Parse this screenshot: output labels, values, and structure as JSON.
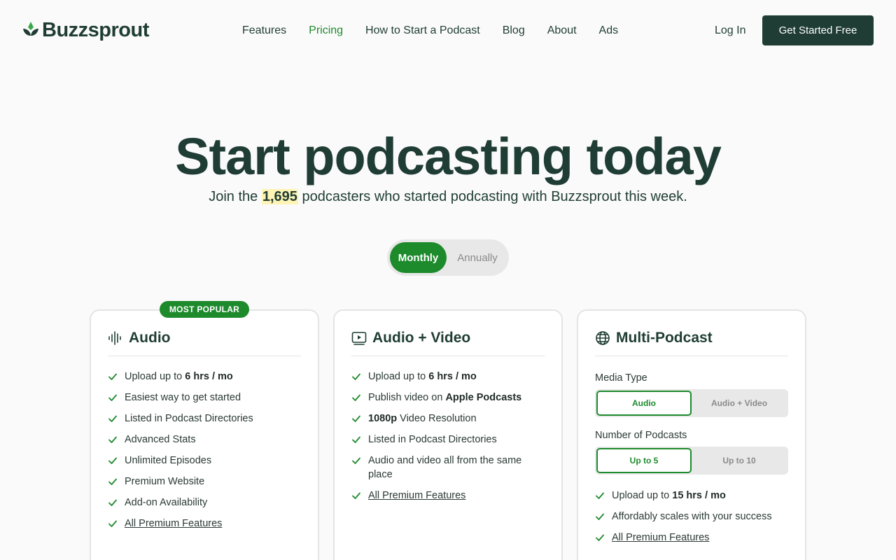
{
  "header": {
    "logo_text": "Buzzsprout",
    "nav": [
      "Features",
      "Pricing",
      "How to Start a Podcast",
      "Blog",
      "About",
      "Ads"
    ],
    "active_nav": "Pricing",
    "login": "Log In",
    "cta": "Get Started Free"
  },
  "hero": {
    "title": "Start podcasting today",
    "sub_before": "Join the ",
    "count": "1,695",
    "sub_after": " podcasters who started podcasting with Buzzsprout this week."
  },
  "billing_toggle": {
    "monthly": "Monthly",
    "annually": "Annually",
    "selected": "Monthly"
  },
  "plans": [
    {
      "badge": "MOST POPULAR",
      "icon": "audio-waveform-icon",
      "title": "Audio",
      "features": [
        {
          "pre": "Upload up to ",
          "bold": "6 hrs / mo",
          "post": ""
        },
        {
          "pre": "Easiest way to get started",
          "bold": "",
          "post": ""
        },
        {
          "pre": "Listed in Podcast Directories",
          "bold": "",
          "post": ""
        },
        {
          "pre": "Advanced Stats",
          "bold": "",
          "post": ""
        },
        {
          "pre": "Unlimited Episodes",
          "bold": "",
          "post": ""
        },
        {
          "pre": "Premium Website",
          "bold": "",
          "post": ""
        },
        {
          "pre": "Add-on Availability",
          "bold": "",
          "post": ""
        }
      ],
      "link": "All Premium Features"
    },
    {
      "icon": "video-play-icon",
      "title": "Audio + Video",
      "features": [
        {
          "pre": "Upload up to ",
          "bold": "6 hrs / mo",
          "post": ""
        },
        {
          "pre": "Publish video on ",
          "bold": "Apple Podcasts",
          "post": ""
        },
        {
          "pre": "",
          "bold": "1080p",
          "post": " Video Resolution"
        },
        {
          "pre": "Listed in Podcast Directories",
          "bold": "",
          "post": ""
        },
        {
          "pre": "Audio and video all from the same place",
          "bold": "",
          "post": ""
        }
      ],
      "link": "All Premium Features"
    },
    {
      "icon": "globe-icon",
      "title": "Multi-Podcast",
      "media_type_label": "Media Type",
      "media_type_options": [
        "Audio",
        "Audio + Video"
      ],
      "media_type_selected": "Audio",
      "num_podcasts_label": "Number of Podcasts",
      "num_podcasts_options": [
        "Up to 5",
        "Up to 10"
      ],
      "num_podcasts_selected": "Up to 5",
      "features": [
        {
          "pre": "Upload up to ",
          "bold": "15 hrs / mo",
          "post": ""
        },
        {
          "pre": "Affordably scales with your success",
          "bold": "",
          "post": ""
        }
      ],
      "link": "All Premium Features"
    }
  ],
  "colors": {
    "brand_dark": "#1f3d34",
    "brand_green": "#1d8a2c",
    "highlight": "#fff4b5"
  }
}
